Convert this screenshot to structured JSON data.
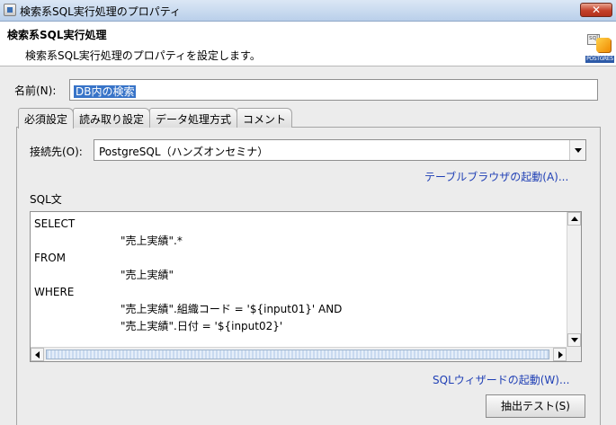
{
  "window": {
    "title": "検索系SQL実行処理のプロパティ",
    "close_label": "✕"
  },
  "header": {
    "title": "検索系SQL実行処理",
    "description": "検索系SQL実行処理のプロパティを設定します。",
    "logo_text": "POSTGRES"
  },
  "name_field": {
    "label": "名前(N):",
    "value": "DB内の検索"
  },
  "tabs": [
    {
      "label": "必須設定",
      "active": true
    },
    {
      "label": "読み取り設定",
      "active": false
    },
    {
      "label": "データ処理方式",
      "active": false
    },
    {
      "label": "コメント",
      "active": false
    }
  ],
  "connection": {
    "label": "接続先(O):",
    "selected": "PostgreSQL（ハンズオンセミナ）"
  },
  "table_browser_link": "テーブルブラウザの起動(A)...",
  "sql": {
    "label": "SQL文",
    "lines": [
      "SELECT",
      "\t\t\t\"売上実績\".*",
      "FROM",
      "\t\t\t\"売上実績\"",
      "WHERE",
      "\t\t\t\"売上実績\".組織コード = '${input01}' AND",
      "\t\t\t\"売上実績\".日付 = '${input02}'"
    ]
  },
  "sql_wizard_link": "SQLウィザードの起動(W)...",
  "extract_test_button": "抽出テスト(S)"
}
